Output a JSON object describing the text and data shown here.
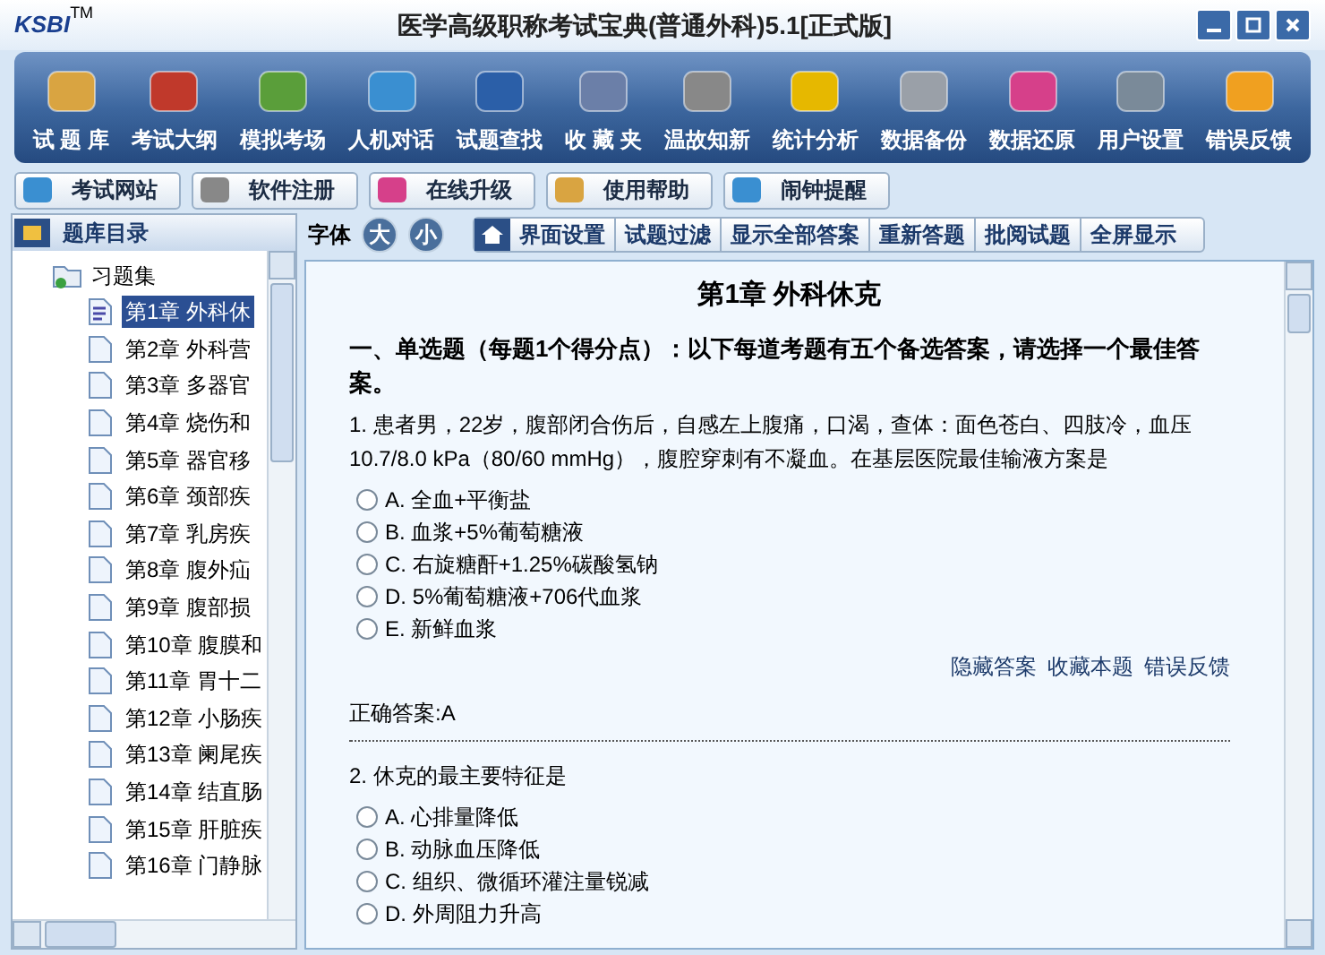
{
  "window": {
    "logo": "KSBI",
    "logo_mark": "TM",
    "title": "医学高级职称考试宝典(普通外科)5.1[正式版]"
  },
  "toolbar": [
    "试 题 库",
    "考试大纲",
    "模拟考场",
    "人机对话",
    "试题查找",
    "收 藏 夹",
    "温故知新",
    "统计分析",
    "数据备份",
    "数据还原",
    "用户设置",
    "错误反馈"
  ],
  "links": [
    "考试网站",
    "软件注册",
    "在线升级",
    "使用帮助",
    "闹钟提醒"
  ],
  "sidebar": {
    "title": "题库目录",
    "root": {
      "label": "习题集",
      "expanded": true,
      "children": [
        {
          "label": "第1章 外科休",
          "selected": true
        },
        {
          "label": "第2章 外科营",
          "selected": false
        },
        {
          "label": "第3章 多器官",
          "selected": false
        },
        {
          "label": "第4章 烧伤和",
          "selected": false
        },
        {
          "label": "第5章 器官移",
          "selected": false
        },
        {
          "label": "第6章 颈部疾",
          "selected": false
        },
        {
          "label": "第7章 乳房疾",
          "selected": false
        },
        {
          "label": "第8章 腹外疝",
          "selected": false
        },
        {
          "label": "第9章 腹部损",
          "selected": false
        },
        {
          "label": "第10章 腹膜和",
          "selected": false
        },
        {
          "label": "第11章 胃十二",
          "selected": false
        },
        {
          "label": "第12章 小肠疾",
          "selected": false
        },
        {
          "label": "第13章 阑尾疾",
          "selected": false
        },
        {
          "label": "第14章 结直肠",
          "selected": false
        },
        {
          "label": "第15章 肝脏疾",
          "selected": false
        },
        {
          "label": "第16章 门静脉",
          "selected": false
        }
      ]
    }
  },
  "content_toolbar": {
    "font_label": "字体",
    "font_buttons": [
      "大",
      "小"
    ],
    "tabs": [
      "界面设置",
      "试题过滤",
      "显示全部答案",
      "重新答题",
      "批阅试题",
      "全屏显示"
    ]
  },
  "content": {
    "chapter_title": "第1章  外科休克",
    "section_heading": "一、单选题（每题1个得分点）：以下每道考题有五个备选答案，请选择一个最佳答案。",
    "questions": [
      {
        "text": "1. 患者男，22岁，腹部闭合伤后，自感左上腹痛，口渴，查体：面色苍白、四肢冷，血压10.7/8.0 kPa（80/60 mmHg），腹腔穿刺有不凝血。在基层医院最佳输液方案是",
        "options": [
          {
            "label": "A. 全血+平衡盐",
            "selected": false
          },
          {
            "label": "B. 血浆+5%葡萄糖液",
            "selected": false
          },
          {
            "label": "C. 右旋糖酐+1.25%碳酸氢钠",
            "selected": false
          },
          {
            "label": "D. 5%葡萄糖液+706代血浆",
            "selected": false
          },
          {
            "label": "E. 新鲜血浆",
            "selected": false
          }
        ],
        "actions": [
          "隐藏答案",
          "收藏本题",
          "错误反馈"
        ],
        "answer": "正确答案:A"
      },
      {
        "text": "2. 休克的最主要特征是",
        "options": [
          {
            "label": "A. 心排量降低",
            "selected": false
          },
          {
            "label": "B. 动脉血压降低",
            "selected": false
          },
          {
            "label": "C. 组织、微循环灌注量锐减",
            "selected": false
          },
          {
            "label": "D. 外周阻力升高",
            "selected": false
          }
        ]
      }
    ]
  }
}
